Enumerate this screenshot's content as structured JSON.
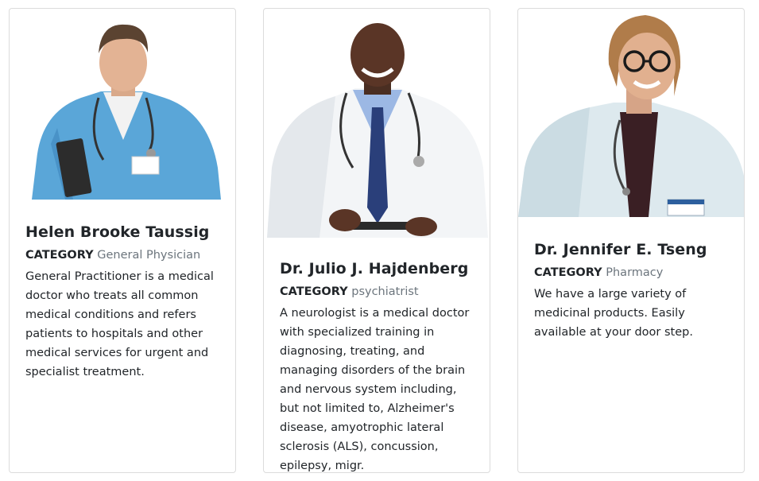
{
  "cards": [
    {
      "name": "Helen Brooke Taussig",
      "category_label": "CATEGORY",
      "category": "General Physician",
      "description": "General Practitioner is a medical doctor who treats all common medical conditions and refers patients to hospitals and other medical services for urgent and specialist treatment."
    },
    {
      "name": "Dr. Julio J. Hajdenberg",
      "category_label": "CATEGORY",
      "category": "psychiatrist",
      "description": "A neurologist is a medical doctor with specialized training in diagnosing, treating, and managing disorders of the brain and nervous system including, but not limited to, Alzheimer's disease, amyotrophic lateral sclerosis (ALS), concussion, epilepsy, migr."
    },
    {
      "name": "Dr. Jennifer E. Tseng",
      "category_label": "CATEGORY",
      "category": "Pharmacy",
      "description": "We have a large variety of medicinal products. Easily available at your door step."
    }
  ]
}
